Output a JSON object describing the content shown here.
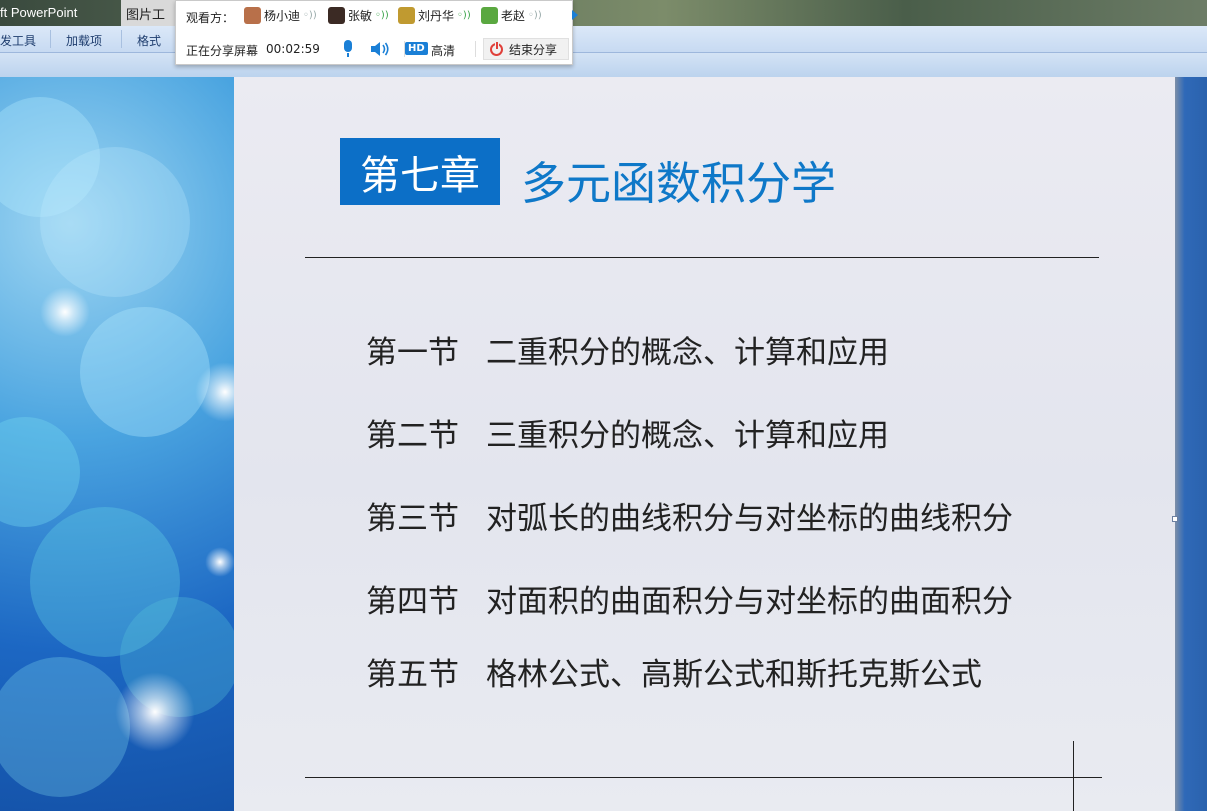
{
  "window": {
    "app_title": "ft PowerPoint",
    "context_tab": "图片工具"
  },
  "ribbon": {
    "tabs": [
      "发工具",
      "加载项",
      "格式"
    ]
  },
  "share_panel": {
    "viewers_label": "观看方：",
    "viewers": [
      {
        "name": "杨小迪",
        "avatar_color": "#b8704a"
      },
      {
        "name": "张敏",
        "avatar_color": "#3b2a24"
      },
      {
        "name": "刘丹华",
        "avatar_color": "#c09a30"
      },
      {
        "name": "老赵",
        "avatar_color": "#5aa840"
      }
    ],
    "status_label": "正在分享屏幕",
    "timer": "00:02:59",
    "hd_badge": "HD",
    "quality_label": "高清",
    "end_button": "结束分享",
    "accent_color": "#1a7fd6"
  },
  "slide": {
    "chapter_label": "第七章",
    "chapter_title": "多元函数积分学",
    "title_color": "#0e78c8",
    "chapter_box_color": "#0c6fc7",
    "sections": [
      {
        "num": "第一节",
        "title": "二重积分的概念、计算和应用"
      },
      {
        "num": "第二节",
        "title": "三重积分的概念、计算和应用"
      },
      {
        "num": "第三节",
        "title": "对弧长的曲线积分与对坐标的曲线积分"
      },
      {
        "num": "第四节",
        "title": "对面积的曲面积分与对坐标的曲面积分"
      },
      {
        "num": "第五节",
        "title": "格林公式、高斯公式和斯托克斯公式"
      }
    ]
  }
}
